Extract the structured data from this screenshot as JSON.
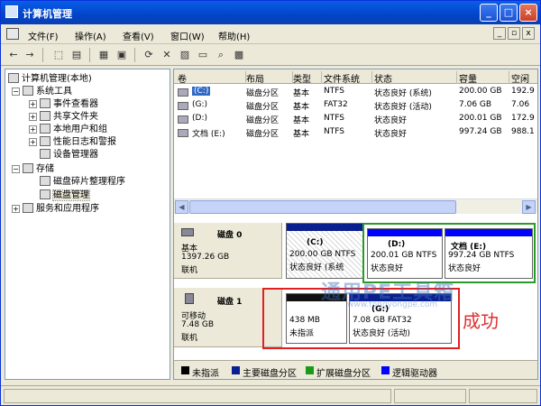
{
  "window": {
    "title": "计算机管理"
  },
  "menu": {
    "items": [
      "文件(F)",
      "操作(A)",
      "查看(V)",
      "窗口(W)",
      "帮助(H)"
    ],
    "mdi_controls": [
      "_",
      "▫",
      "x"
    ]
  },
  "toolbar": {
    "icons": [
      "back-icon",
      "forward-icon",
      "up-icon",
      "show-tree-icon",
      "properties-icon",
      "refresh-icon",
      "delete-icon",
      "properties2-icon",
      "open-icon",
      "search-icon",
      "help-icon"
    ]
  },
  "tree": {
    "items": [
      {
        "label": "计算机管理(本地)",
        "expander": "",
        "icon": "computer-icon"
      },
      {
        "label": "系统工具",
        "expander": "−",
        "icon": "tools-icon"
      },
      {
        "label": "事件查看器",
        "expander": "+",
        "icon": "event-viewer-icon"
      },
      {
        "label": "共享文件夹",
        "expander": "+",
        "icon": "shared-folder-icon"
      },
      {
        "label": "本地用户和组",
        "expander": "+",
        "icon": "users-icon"
      },
      {
        "label": "性能日志和警报",
        "expander": "+",
        "icon": "performance-icon"
      },
      {
        "label": "设备管理器",
        "expander": "",
        "icon": "device-manager-icon"
      },
      {
        "label": "存储",
        "expander": "−",
        "icon": "storage-icon"
      },
      {
        "label": "磁盘碎片整理程序",
        "expander": "",
        "icon": "defrag-icon"
      },
      {
        "label": "磁盘管理",
        "expander": "",
        "icon": "disk-management-icon"
      },
      {
        "label": "服务和应用程序",
        "expander": "+",
        "icon": "services-icon"
      }
    ]
  },
  "volume_list": {
    "columns": [
      "卷",
      "布局",
      "类型",
      "文件系统",
      "状态",
      "容量",
      "空闲"
    ],
    "rows": [
      {
        "vol": "(C:)",
        "layout": "磁盘分区",
        "type": "基本",
        "fs": "NTFS",
        "status": "状态良好 (系统)",
        "cap": "200.00 GB",
        "free": "192.9"
      },
      {
        "vol": "(G:)",
        "layout": "磁盘分区",
        "type": "基本",
        "fs": "FAT32",
        "status": "状态良好 (活动)",
        "cap": "7.06 GB",
        "free": "7.06"
      },
      {
        "vol": "(D:)",
        "layout": "磁盘分区",
        "type": "基本",
        "fs": "NTFS",
        "status": "状态良好",
        "cap": "200.01 GB",
        "free": "172.9"
      },
      {
        "vol": "文档 (E:)",
        "layout": "磁盘分区",
        "type": "基本",
        "fs": "NTFS",
        "status": "状态良好",
        "cap": "997.24 GB",
        "free": "988.1"
      }
    ]
  },
  "disks": [
    {
      "name": "磁盘 0",
      "kind": "基本",
      "size": "1397.26 GB",
      "state": "联机",
      "partitions": [
        {
          "label": "(C:)",
          "size": "200.00 GB NTFS",
          "status": "状态良好 (系统",
          "bar_color": "#0a1f8f"
        },
        {
          "label": "(D:)",
          "size": "200.01 GB NTFS",
          "status": "状态良好",
          "bar_color": "#0000ff"
        },
        {
          "label": "文档  (E:)",
          "size": "997.24 GB NTFS",
          "status": "状态良好",
          "bar_color": "#0000ff"
        }
      ]
    },
    {
      "name": "磁盘 1",
      "kind": "可移动",
      "size": "7.48 GB",
      "state": "联机",
      "partitions": [
        {
          "label": "",
          "size": "438 MB",
          "status": "未指派",
          "bar_color": "#111111"
        },
        {
          "label": "(G:)",
          "size": "7.08 GB FAT32",
          "status": "状态良好 (活动)",
          "bar_color": "#0a1f8f"
        }
      ]
    }
  ],
  "legend": [
    {
      "label": "未指派",
      "color": "#000000"
    },
    {
      "label": "主要磁盘分区",
      "color": "#0a1f8f"
    },
    {
      "label": "扩展磁盘分区",
      "color": "#1a9a1a"
    },
    {
      "label": "逻辑驱动器",
      "color": "#0000ff"
    }
  ],
  "annotation": {
    "note": "成功",
    "watermark": "通用PE工具箱",
    "watermark_url": "www.tongyongpe.com"
  }
}
